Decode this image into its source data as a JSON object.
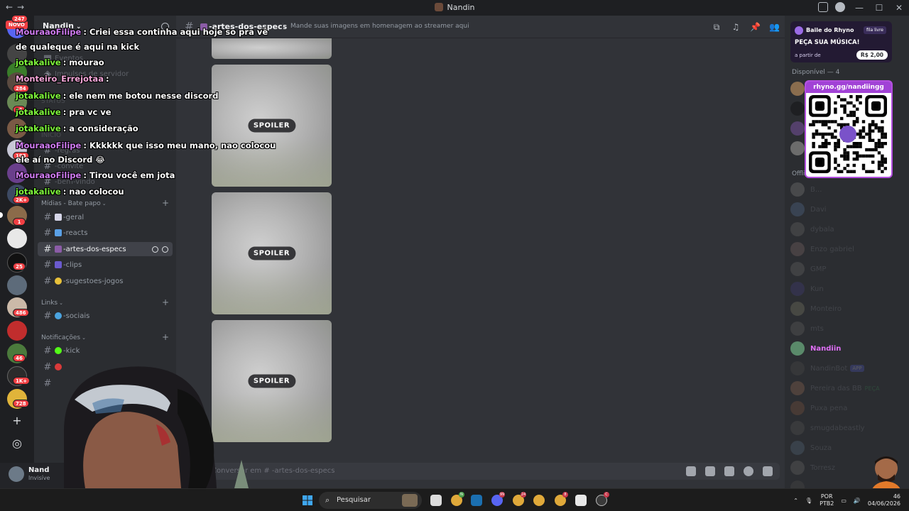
{
  "window": {
    "title": "Nandin",
    "controls": [
      "—",
      "☐",
      "✕"
    ]
  },
  "rail": {
    "new_badge": "NOVO",
    "top_count": "247",
    "badges": [
      "4",
      "284",
      "91",
      "4",
      "193",
      "2K+",
      "1",
      "25",
      "486",
      "46",
      "1K+",
      "728"
    ]
  },
  "sidebar": {
    "server_name": "Nandin",
    "faded_items": [
      "Eventos",
      "Impulsos de servidor",
      "STATUS",
      "INÍCIO",
      "-regras",
      "-convite",
      "-bem-vindo"
    ],
    "categories": {
      "midias": "Mídias - Bate papo",
      "links": "Links",
      "notificacoes": "Notificações"
    },
    "channels": {
      "geral": "-geral",
      "reacts": "-reacts",
      "artes": "-artes-dos-especs",
      "clips": "-clips",
      "sugestoes": "-sugestoes-jogos",
      "sociais": "-sociais",
      "kick": "-kick"
    }
  },
  "user_panel": {
    "name": "Nand",
    "status": "Invisíve"
  },
  "header": {
    "channel": "-artes-dos-especs",
    "topic": "Mande suas imagens em homenagem ao streamer aqui"
  },
  "messages": {
    "spoiler_label": "SPOILER"
  },
  "composer": {
    "placeholder": "Conversar em # -artes-dos-especs"
  },
  "members": {
    "online_header": "Disponível — 4",
    "offline_header": "Offli",
    "list": [
      {
        "name": "B..."
      },
      {
        "name": "Davi"
      },
      {
        "name": "dybala"
      },
      {
        "name": "Enzo gabriel"
      },
      {
        "name": "GMP"
      },
      {
        "name": "Kun"
      },
      {
        "name": "Monteiro"
      },
      {
        "name": "mts"
      },
      {
        "name": "Nandiin"
      },
      {
        "name": "NandinBot",
        "tag": "APP"
      },
      {
        "name": "Pereira das BB",
        "tag": "PEÇA"
      },
      {
        "name": "Puxa pena"
      },
      {
        "name": "smugdabeastly"
      },
      {
        "name": "Souza"
      },
      {
        "name": "Torresz"
      },
      {
        "name": "..."
      }
    ]
  },
  "promo": {
    "brand": "Baile do Rhyno",
    "tag": "fila livre",
    "headline": "PEÇA SUA MÚSICA!",
    "from": "a partir de",
    "price": "R$ 2,00"
  },
  "qr": {
    "url": "rhyno.gg/nandiingg"
  },
  "chat": [
    {
      "user": "MouraaoFilipe",
      "color": "purple",
      "text": ": Criei essa continha aqui hoje so pra vê"
    },
    {
      "user": "",
      "color": "",
      "text": "de qualeque é aqui na kick"
    },
    {
      "user": "jotakalive",
      "color": "green",
      "text": ": mourao"
    },
    {
      "user": "Monteiro_Errejotaa",
      "color": "pink",
      "text": ":"
    },
    {
      "user": "jotakalive",
      "color": "green",
      "text": ": ele nem me botou nesse discord"
    },
    {
      "user": "jotakalive",
      "color": "green",
      "text": ": pra vc ve"
    },
    {
      "user": "jotakalive",
      "color": "green",
      "text": ": a consideração"
    },
    {
      "user": "MouraaoFilipe",
      "color": "purple",
      "text": ": Kkkkkk que isso meu mano, nao colocou"
    },
    {
      "user": "",
      "color": "",
      "text": "ele aí no Discord 😂"
    },
    {
      "user": "MouraaoFilipe",
      "color": "purple",
      "text": ": Tirou você em jota"
    },
    {
      "user": "jotakalive",
      "color": "green",
      "text": ": nao colocou"
    }
  ],
  "taskbar": {
    "search": "Pesquisar",
    "lang1": "POR",
    "lang2": "PTB2",
    "time": "46",
    "date": "04/06/2026",
    "badges": [
      "N",
      "99",
      "24",
      "8",
      "C"
    ]
  }
}
